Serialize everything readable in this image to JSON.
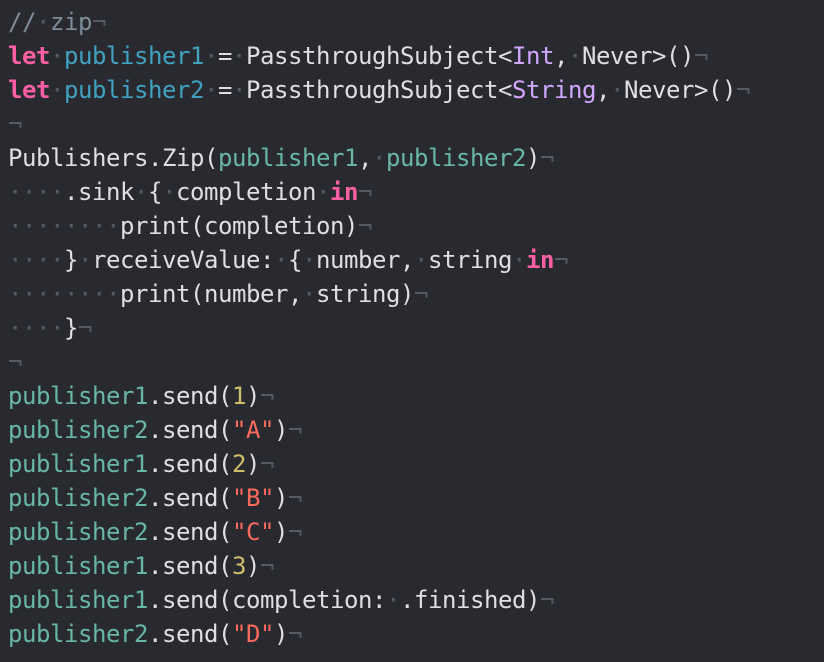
{
  "editor": {
    "colors": {
      "background": "#292a30",
      "comment": "#7f8c98",
      "keyword": "#fc5fa3",
      "declaration": "#41a1c0",
      "plain": "#dfdfe0",
      "type": "#d0a8ff",
      "identifier": "#67b7a4",
      "number": "#d0bf69",
      "string": "#fc6a5d",
      "invisible": "#565a63"
    },
    "lines": [
      [
        [
          "comment",
          "//"
        ],
        [
          "invisible",
          "·"
        ],
        [
          "comment",
          "zip"
        ],
        [
          "invisible",
          "¬"
        ]
      ],
      [
        [
          "keyword",
          "let"
        ],
        [
          "invisible",
          "·"
        ],
        [
          "decl",
          "publisher1"
        ],
        [
          "invisible",
          "·"
        ],
        [
          "plain",
          "="
        ],
        [
          "invisible",
          "·"
        ],
        [
          "plain",
          "PassthroughSubject<"
        ],
        [
          "type",
          "Int"
        ],
        [
          "plain",
          ","
        ],
        [
          "invisible",
          "·"
        ],
        [
          "plain",
          "Never>()"
        ],
        [
          "invisible",
          "¬"
        ]
      ],
      [
        [
          "keyword",
          "let"
        ],
        [
          "invisible",
          "·"
        ],
        [
          "decl",
          "publisher2"
        ],
        [
          "invisible",
          "·"
        ],
        [
          "plain",
          "="
        ],
        [
          "invisible",
          "·"
        ],
        [
          "plain",
          "PassthroughSubject<"
        ],
        [
          "type",
          "String"
        ],
        [
          "plain",
          ","
        ],
        [
          "invisible",
          "·"
        ],
        [
          "plain",
          "Never>()"
        ],
        [
          "invisible",
          "¬"
        ]
      ],
      [
        [
          "invisible",
          "¬"
        ]
      ],
      [
        [
          "plain",
          "Publishers.Zip("
        ],
        [
          "ident",
          "publisher1"
        ],
        [
          "plain",
          ","
        ],
        [
          "invisible",
          "·"
        ],
        [
          "ident",
          "publisher2"
        ],
        [
          "plain",
          ")"
        ],
        [
          "invisible",
          "¬"
        ]
      ],
      [
        [
          "invisible",
          "····"
        ],
        [
          "plain",
          ".sink"
        ],
        [
          "invisible",
          "·"
        ],
        [
          "plain",
          "{"
        ],
        [
          "invisible",
          "·"
        ],
        [
          "plain",
          "completion"
        ],
        [
          "invisible",
          "·"
        ],
        [
          "keyword",
          "in"
        ],
        [
          "invisible",
          "¬"
        ]
      ],
      [
        [
          "invisible",
          "········"
        ],
        [
          "plain",
          "print(completion)"
        ],
        [
          "invisible",
          "¬"
        ]
      ],
      [
        [
          "invisible",
          "····"
        ],
        [
          "plain",
          "}"
        ],
        [
          "invisible",
          "·"
        ],
        [
          "plain",
          "receiveValue:"
        ],
        [
          "invisible",
          "·"
        ],
        [
          "plain",
          "{"
        ],
        [
          "invisible",
          "·"
        ],
        [
          "plain",
          "number,"
        ],
        [
          "invisible",
          "·"
        ],
        [
          "plain",
          "string"
        ],
        [
          "invisible",
          "·"
        ],
        [
          "keyword",
          "in"
        ],
        [
          "invisible",
          "¬"
        ]
      ],
      [
        [
          "invisible",
          "········"
        ],
        [
          "plain",
          "print(number,"
        ],
        [
          "invisible",
          "·"
        ],
        [
          "plain",
          "string)"
        ],
        [
          "invisible",
          "¬"
        ]
      ],
      [
        [
          "invisible",
          "····"
        ],
        [
          "plain",
          "}"
        ],
        [
          "invisible",
          "¬"
        ]
      ],
      [
        [
          "invisible",
          "¬"
        ]
      ],
      [
        [
          "ident",
          "publisher1"
        ],
        [
          "plain",
          ".send("
        ],
        [
          "number",
          "1"
        ],
        [
          "plain",
          ")"
        ],
        [
          "invisible",
          "¬"
        ]
      ],
      [
        [
          "ident",
          "publisher2"
        ],
        [
          "plain",
          ".send("
        ],
        [
          "string",
          "\"A\""
        ],
        [
          "plain",
          ")"
        ],
        [
          "invisible",
          "¬"
        ]
      ],
      [
        [
          "ident",
          "publisher1"
        ],
        [
          "plain",
          ".send("
        ],
        [
          "number",
          "2"
        ],
        [
          "plain",
          ")"
        ],
        [
          "invisible",
          "¬"
        ]
      ],
      [
        [
          "ident",
          "publisher2"
        ],
        [
          "plain",
          ".send("
        ],
        [
          "string",
          "\"B\""
        ],
        [
          "plain",
          ")"
        ],
        [
          "invisible",
          "¬"
        ]
      ],
      [
        [
          "ident",
          "publisher2"
        ],
        [
          "plain",
          ".send("
        ],
        [
          "string",
          "\"C\""
        ],
        [
          "plain",
          ")"
        ],
        [
          "invisible",
          "¬"
        ]
      ],
      [
        [
          "ident",
          "publisher1"
        ],
        [
          "plain",
          ".send("
        ],
        [
          "number",
          "3"
        ],
        [
          "plain",
          ")"
        ],
        [
          "invisible",
          "¬"
        ]
      ],
      [
        [
          "ident",
          "publisher1"
        ],
        [
          "plain",
          ".send(completion:"
        ],
        [
          "invisible",
          "·"
        ],
        [
          "plain",
          ".finished)"
        ],
        [
          "invisible",
          "¬"
        ]
      ],
      [
        [
          "ident",
          "publisher2"
        ],
        [
          "plain",
          ".send("
        ],
        [
          "string",
          "\"D\""
        ],
        [
          "plain",
          ")"
        ],
        [
          "invisible",
          "¬"
        ]
      ]
    ]
  }
}
